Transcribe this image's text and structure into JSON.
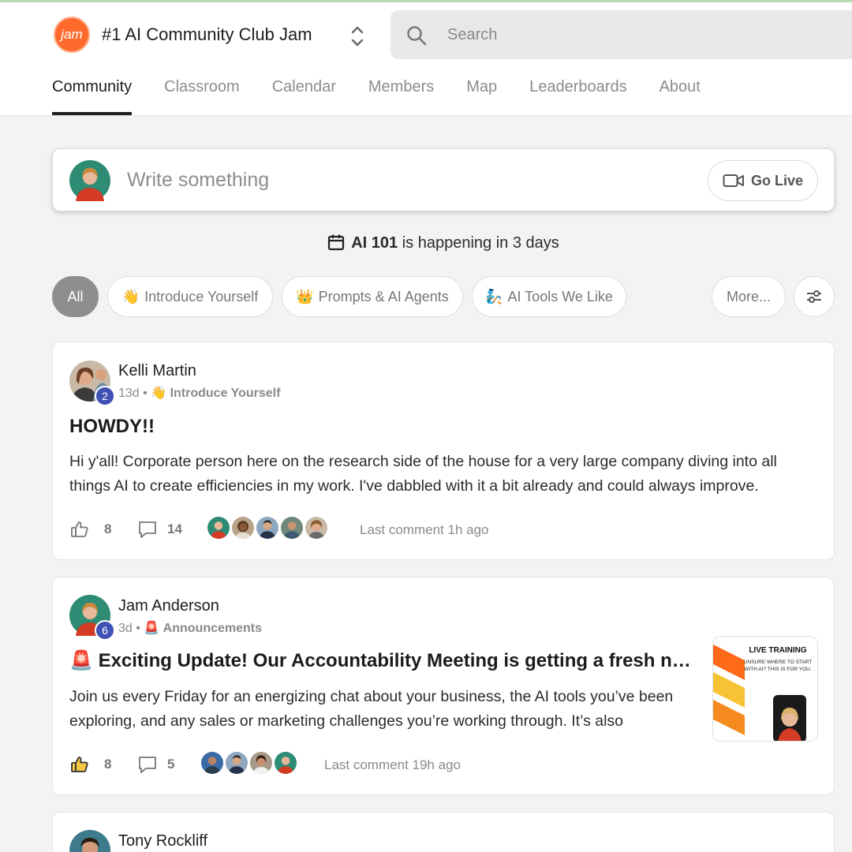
{
  "header": {
    "logo_text": "jam",
    "group_title": "#1 AI Community Club Jam",
    "search_placeholder": "Search",
    "tabs": [
      {
        "label": "Community",
        "active": true
      },
      {
        "label": "Classroom"
      },
      {
        "label": "Calendar"
      },
      {
        "label": "Members"
      },
      {
        "label": "Map"
      },
      {
        "label": "Leaderboards"
      },
      {
        "label": "About"
      }
    ]
  },
  "composer": {
    "placeholder": "Write something",
    "go_live_label": "Go Live"
  },
  "event_banner": {
    "event_name": "AI 101",
    "suffix": "is happening in 3 days"
  },
  "filters": {
    "chips": [
      {
        "label": "All",
        "emoji": ""
      },
      {
        "label": "Introduce Yourself",
        "emoji": "👋"
      },
      {
        "label": "Prompts & AI Agents",
        "emoji": "👑"
      },
      {
        "label": "AI Tools We Like",
        "emoji": "🧞"
      },
      {
        "label": "More...",
        "emoji": ""
      }
    ]
  },
  "posts": [
    {
      "author": "Kelli Martin",
      "level": "2",
      "age": "13d",
      "category_emoji": "👋",
      "category": "Introduce Yourself",
      "title": "HOWDY!!",
      "body": "Hi y'all! Corporate person here on the research side of the house for a very large company diving into all things AI to create efficiencies in my work. I've dabbled with it a bit already and could always improve.",
      "likes": "8",
      "comments": "14",
      "last_comment": "Last comment 1h ago"
    },
    {
      "author": "Jam Anderson",
      "level": "6",
      "age": "3d",
      "category_emoji": "🚨",
      "category": "Announcements",
      "title_emoji": "🚨",
      "title": "Exciting Update! Our Accountability Meeting is getting a fresh n…",
      "body": "Join us every Friday for an energizing chat about your business, the AI tools you’ve been exploring, and any sales or marketing challenges you’re working through. It’s also",
      "likes": "8",
      "comments": "5",
      "last_comment": "Last comment 19h ago",
      "thumbnail": {
        "heading": "LIVE TRAINING",
        "subtext": "UNSURE WHERE TO START WITH AI? THIS IS FOR YOU."
      }
    },
    {
      "author": "Tony Rockliff"
    }
  ],
  "colors": {
    "accent_orange": "#ff6a2c",
    "level_badge": "#3f51b5",
    "active_chip": "#8e8e8e"
  }
}
